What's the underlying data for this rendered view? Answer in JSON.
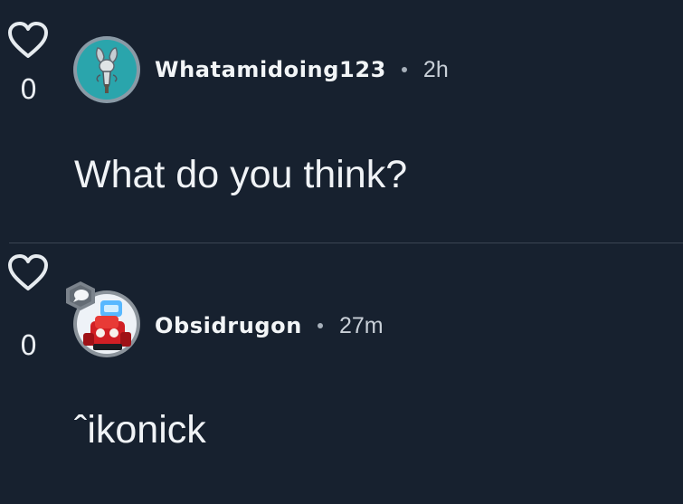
{
  "comments": [
    {
      "likes": "0",
      "username": "Whatamidoing123",
      "separator": "•",
      "time": "2h",
      "text": "What do you think?",
      "avatar_icon": "rabbit-figure-avatar"
    },
    {
      "likes": "0",
      "username": "Obsidrugon",
      "separator": "•",
      "time": "27m",
      "text": "ˆikonick",
      "avatar_icon": "robot-character-avatar"
    }
  ],
  "colors": {
    "background": "#17212f",
    "text": "#f0f3f6",
    "muted": "#a7b0ba",
    "avatar_teal": "#2aa5ac"
  }
}
